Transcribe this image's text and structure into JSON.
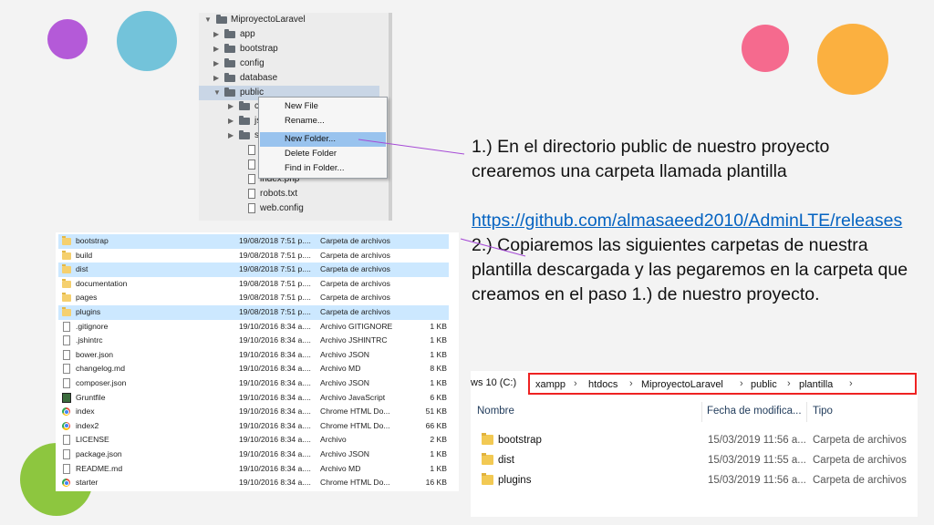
{
  "colors": {
    "circle_purple": "#b45ad8",
    "circle_blue": "#73c3da",
    "circle_pink": "#f56a8e",
    "circle_orange": "#fbb040",
    "circle_green": "#8dc63f",
    "arrow_purple": "#a64ad6",
    "highlight_red": "#e22222",
    "link_blue": "#0563c1"
  },
  "file_tree": {
    "root": "MiproyectoLaravel",
    "items": [
      {
        "label": "app",
        "kind": "folder"
      },
      {
        "label": "bootstrap",
        "kind": "folder"
      },
      {
        "label": "config",
        "kind": "folder"
      },
      {
        "label": "database",
        "kind": "folder"
      },
      {
        "label": "public",
        "kind": "folder-open"
      },
      {
        "label": "cs",
        "kind": "folder"
      },
      {
        "label": "js",
        "kind": "folder"
      },
      {
        "label": "sv",
        "kind": "folder"
      },
      {
        "label": ".h",
        "kind": "file"
      },
      {
        "label": "fa",
        "kind": "file"
      },
      {
        "label": "index.php",
        "kind": "file"
      },
      {
        "label": "robots.txt",
        "kind": "file"
      },
      {
        "label": "web.config",
        "kind": "file"
      }
    ]
  },
  "context_menu": {
    "items": [
      "New File",
      "Rename...",
      "New Folder...",
      "Delete Folder",
      "Find in Folder..."
    ],
    "highlighted": "New Folder..."
  },
  "file_list": {
    "rows": [
      {
        "name": "bootstrap",
        "date": "19/08/2018 7:51 p....",
        "type": "Carpeta de archivos",
        "size": "",
        "icon": "folder"
      },
      {
        "name": "build",
        "date": "19/08/2018 7:51 p....",
        "type": "Carpeta de archivos",
        "size": "",
        "icon": "folder"
      },
      {
        "name": "dist",
        "date": "19/08/2018 7:51 p....",
        "type": "Carpeta de archivos",
        "size": "",
        "icon": "folder"
      },
      {
        "name": "documentation",
        "date": "19/08/2018 7:51 p....",
        "type": "Carpeta de archivos",
        "size": "",
        "icon": "folder"
      },
      {
        "name": "pages",
        "date": "19/08/2018 7:51 p....",
        "type": "Carpeta de archivos",
        "size": "",
        "icon": "folder"
      },
      {
        "name": "plugins",
        "date": "19/08/2018 7:51 p....",
        "type": "Carpeta de archivos",
        "size": "",
        "icon": "folder"
      },
      {
        "name": ".gitignore",
        "date": "19/10/2016 8:34 a....",
        "type": "Archivo GITIGNORE",
        "size": "1 KB",
        "icon": "file"
      },
      {
        "name": ".jshintrc",
        "date": "19/10/2016 8:34 a....",
        "type": "Archivo JSHINTRC",
        "size": "1 KB",
        "icon": "file"
      },
      {
        "name": "bower.json",
        "date": "19/10/2016 8:34 a....",
        "type": "Archivo JSON",
        "size": "1 KB",
        "icon": "file"
      },
      {
        "name": "changelog.md",
        "date": "19/10/2016 8:34 a....",
        "type": "Archivo MD",
        "size": "8 KB",
        "icon": "file"
      },
      {
        "name": "composer.json",
        "date": "19/10/2016 8:34 a....",
        "type": "Archivo JSON",
        "size": "1 KB",
        "icon": "file"
      },
      {
        "name": "Gruntfile",
        "date": "19/10/2016 8:34 a....",
        "type": "Archivo JavaScript",
        "size": "6 KB",
        "icon": "js"
      },
      {
        "name": "index",
        "date": "19/10/2016 8:34 a....",
        "type": "Chrome HTML Do...",
        "size": "51 KB",
        "icon": "chrome"
      },
      {
        "name": "index2",
        "date": "19/10/2016 8:34 a....",
        "type": "Chrome HTML Do...",
        "size": "66 KB",
        "icon": "chrome"
      },
      {
        "name": "LICENSE",
        "date": "19/10/2016 8:34 a....",
        "type": "Archivo",
        "size": "2 KB",
        "icon": "file"
      },
      {
        "name": "package.json",
        "date": "19/10/2016 8:34 a....",
        "type": "Archivo JSON",
        "size": "1 KB",
        "icon": "file"
      },
      {
        "name": "README.md",
        "date": "19/10/2016 8:34 a....",
        "type": "Archivo MD",
        "size": "1 KB",
        "icon": "file"
      },
      {
        "name": "starter",
        "date": "19/10/2016 8:34 a....",
        "type": "Chrome HTML Do...",
        "size": "16 KB",
        "icon": "chrome"
      }
    ],
    "selected": [
      "bootstrap",
      "dist",
      "plugins"
    ]
  },
  "explorer": {
    "address_prefix": "ws 10 (C:)",
    "breadcrumbs": [
      "xampp",
      "htdocs",
      "MiproyectoLaravel",
      "public",
      "plantilla"
    ],
    "columns": {
      "name": "Nombre",
      "date": "Fecha de modifica...",
      "type": "Tipo"
    },
    "rows": [
      {
        "name": "bootstrap",
        "date": "15/03/2019 11:56 a...",
        "type": "Carpeta de archivos"
      },
      {
        "name": "dist",
        "date": "15/03/2019 11:55 a...",
        "type": "Carpeta de archivos"
      },
      {
        "name": "plugins",
        "date": "15/03/2019 11:56 a...",
        "type": "Carpeta de archivos"
      }
    ]
  },
  "instructions": {
    "step1": "1.)  En el directorio public de nuestro proyecto crearemos una carpeta llamada plantilla",
    "link": "https://github.com/almasaeed2010/AdminLTE/releases",
    "step2": " 2.) Copiaremos las siguientes carpetas de nuestra plantilla descargada y las pegaremos en la carpeta que creamos en el paso 1.) de nuestro proyecto."
  }
}
